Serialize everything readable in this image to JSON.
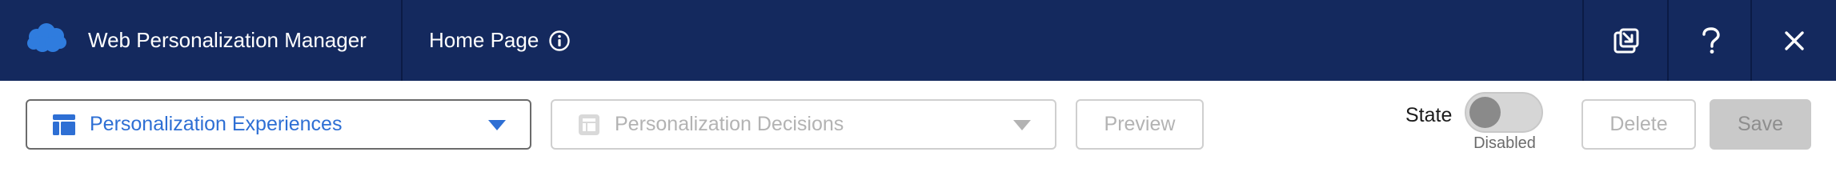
{
  "header": {
    "logo_icon": "cloud-logo-icon",
    "app_title": "Web Personalization Manager",
    "page_name": "Home Page",
    "info_icon": "info-circle-icon",
    "buttons": [
      {
        "name": "popout-button",
        "icon": "popout-icon"
      },
      {
        "name": "help-button",
        "icon": "question-mark-icon"
      },
      {
        "name": "close-button",
        "icon": "close-icon"
      }
    ],
    "colors": {
      "background": "#14295e",
      "divider": "#0b1b45",
      "text": "#ffffff"
    }
  },
  "toolbar": {
    "experiences_select": {
      "label": "Personalization Experiences",
      "icon": "layout-table-icon",
      "caret": "caret-down-icon",
      "color": "#2e6fd4"
    },
    "decisions_select": {
      "label": "Personalization Decisions",
      "icon": "layout-table-icon",
      "caret": "caret-down-icon",
      "disabled": true
    },
    "preview_label": "Preview",
    "state": {
      "label": "State",
      "value": "Disabled",
      "on": false
    },
    "delete_label": "Delete",
    "save_label": "Save"
  }
}
